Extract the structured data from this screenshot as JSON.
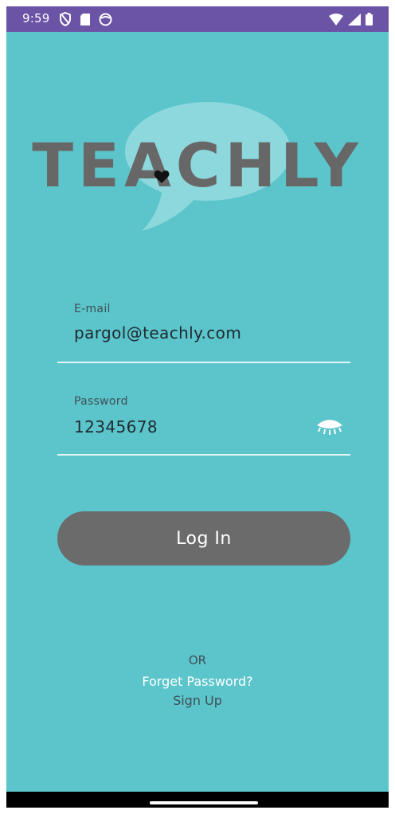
{
  "status_bar": {
    "time": "9:59",
    "left_icons": [
      "shield-icon",
      "sd-card-icon",
      "face-icon"
    ],
    "right_icons": [
      "wifi-icon",
      "cell-signal-icon",
      "battery-icon"
    ],
    "background": "#6B53A6"
  },
  "logo": {
    "text": "TEACHLY",
    "bubble_color": "#8DD8DD",
    "text_color": "#676767",
    "heart_icon": "heart-icon"
  },
  "form": {
    "email": {
      "label": "E-mail",
      "value": "pargol@teachly.com"
    },
    "password": {
      "label": "Password",
      "value": "12345678",
      "toggle_icon": "eye-closed-icon"
    },
    "login_label": "Log In"
  },
  "footer": {
    "or": "OR",
    "forgot": "Forget Password?",
    "signup": "Sign Up"
  },
  "colors": {
    "background": "#5BC5CB",
    "button": "#6B6B6B",
    "underline": "#E6F6F7"
  }
}
